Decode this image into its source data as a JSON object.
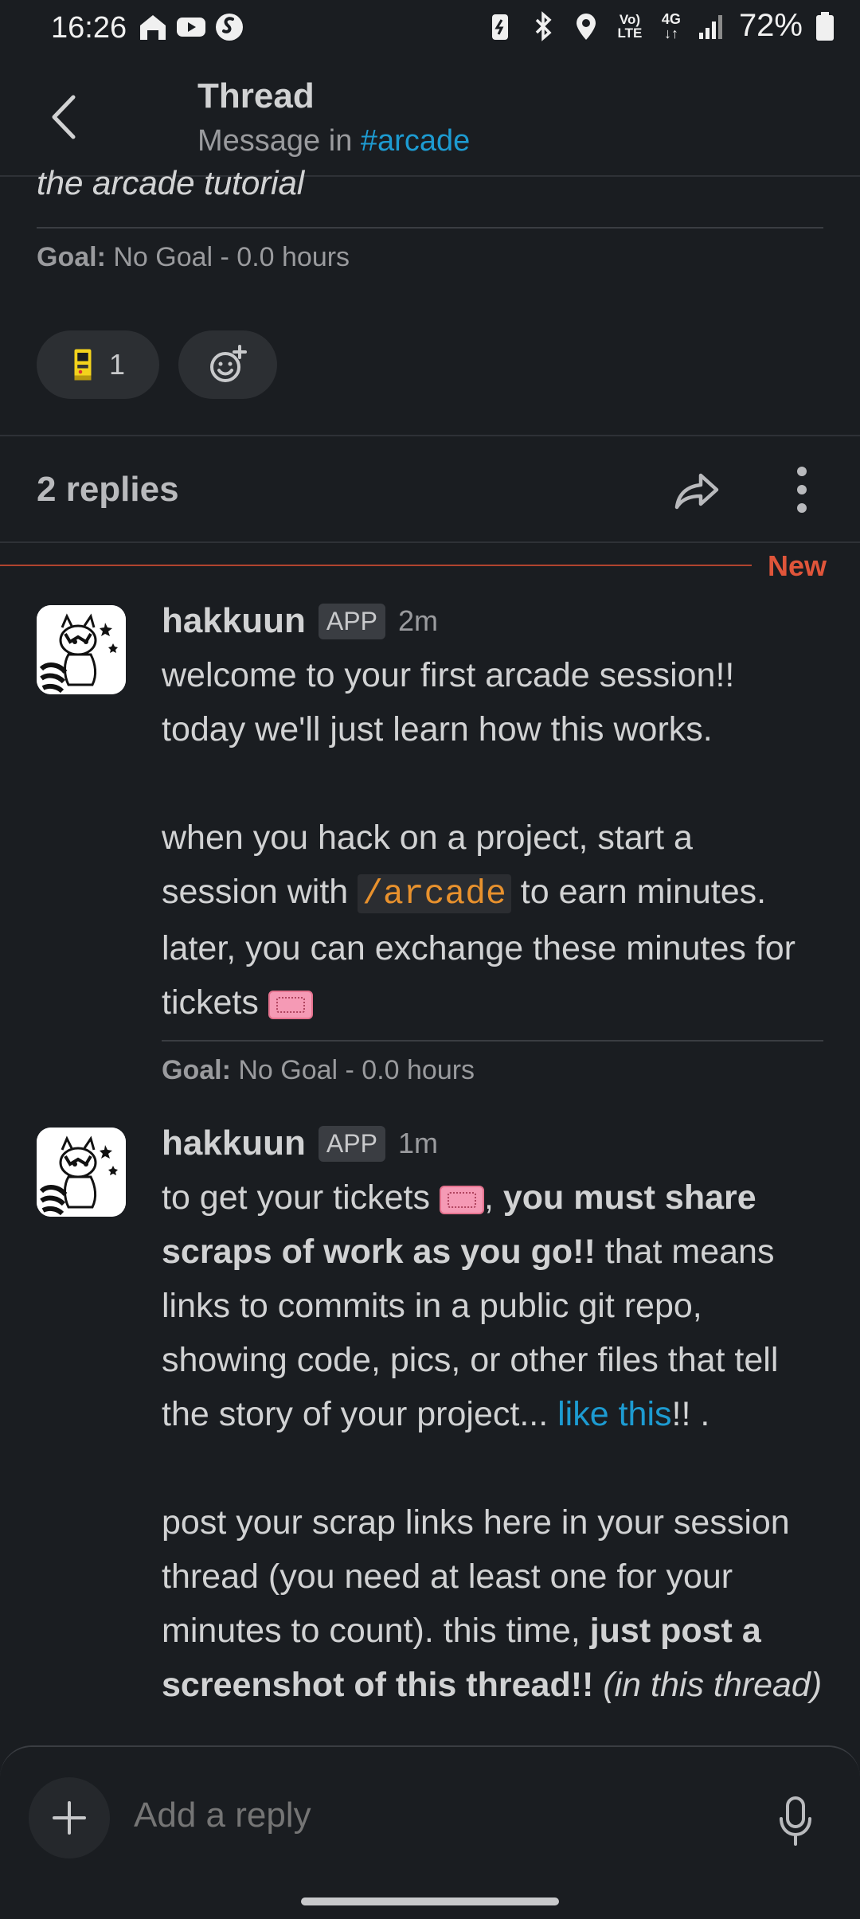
{
  "status_bar": {
    "time": "16:26",
    "battery": "72%",
    "network_top": "Vo)",
    "network_bottom": "LTE",
    "network_gen": "4G"
  },
  "header": {
    "title": "Thread",
    "subtitle_prefix": "Message in ",
    "channel": "#arcade"
  },
  "parent": {
    "partial_text": "the arcade tutorial",
    "goal_label": "Goal:",
    "goal_value": " No Goal - 0.0 hours",
    "reaction_count": "1"
  },
  "thread": {
    "replies_label": "2 replies",
    "new_label": "New"
  },
  "messages": [
    {
      "author": "hakkuun",
      "badge": "APP",
      "time": "2m",
      "l1": "welcome to your first arcade session!!",
      "l2": "today we'll just learn how this works.",
      "l3": "when you hack on a project, start a",
      "l4a": "session with ",
      "l4code": "/arcade",
      "l4b": " to earn minutes.",
      "l5": "later, you can exchange these minutes for",
      "l6": "tickets ",
      "goal_label": "Goal:",
      "goal_value": " No Goal - 0.0 hours"
    },
    {
      "author": "hakkuun",
      "badge": "APP",
      "time": "1m",
      "l1a": "to get your tickets ",
      "l1b": ", ",
      "l1bold": "you must share",
      "l2bold": "scraps of work as you go!!",
      "l2b": " that means",
      "l3": "links to commits in a public git repo,",
      "l4": "showing code, pics, or other files that tell",
      "l5a": "the story of your project... ",
      "l5link": "like this",
      "l5b": "!! .",
      "l6": "post your scrap links here in your session",
      "l7": "thread (you need at least one for your",
      "l8a": "minutes to count). this time, ",
      "l8bold": "just post a",
      "l9bold": "screenshot of this thread!!",
      "l9italic": " (in this thread)"
    }
  ],
  "composer": {
    "placeholder": "Add a reply"
  }
}
